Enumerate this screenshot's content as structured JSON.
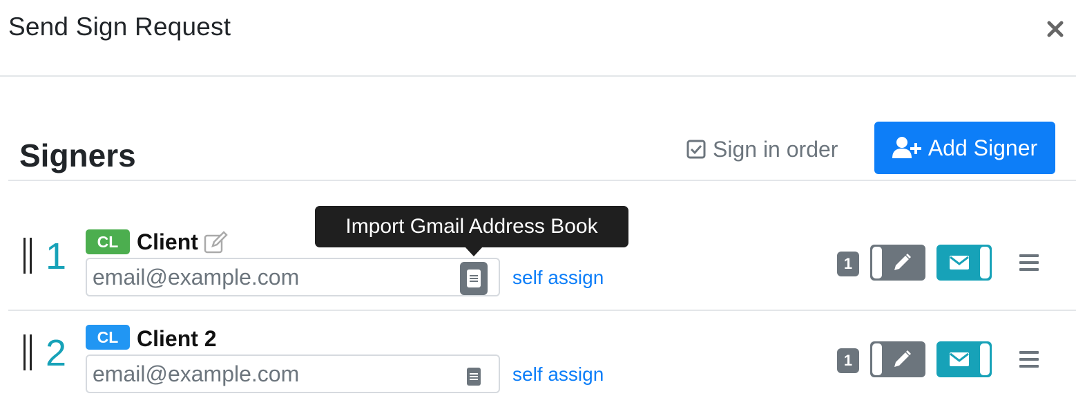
{
  "modal": {
    "title": "Send Sign Request",
    "close_icon": "close-icon"
  },
  "signers_section": {
    "heading": "Signers",
    "sign_in_order": {
      "label": "Sign in order",
      "checked": true
    },
    "add_signer": {
      "label": "Add Signer",
      "icon": "user-plus-icon",
      "color": "#0d7ef8"
    }
  },
  "tooltip": {
    "text": "Import Gmail Address Book"
  },
  "signers": [
    {
      "order": "1",
      "role_badge": "CL",
      "role_badge_color": "#4cae4f",
      "role_name": "Client",
      "email_placeholder": "email@example.com",
      "email_value": "",
      "address_book_icon": "address-book-icon",
      "self_assign": "self assign",
      "count": "1"
    },
    {
      "order": "2",
      "role_badge": "CL",
      "role_badge_color": "#2196f3",
      "role_name": "Client 2",
      "email_placeholder": "email@example.com",
      "email_value": "",
      "address_book_icon": "address-book-icon",
      "self_assign": "self assign",
      "count": "1"
    }
  ],
  "colors": {
    "primary": "#0d7ef8",
    "teal": "#17a2b8",
    "gray": "#6c757d",
    "link": "#0d7ef8"
  }
}
